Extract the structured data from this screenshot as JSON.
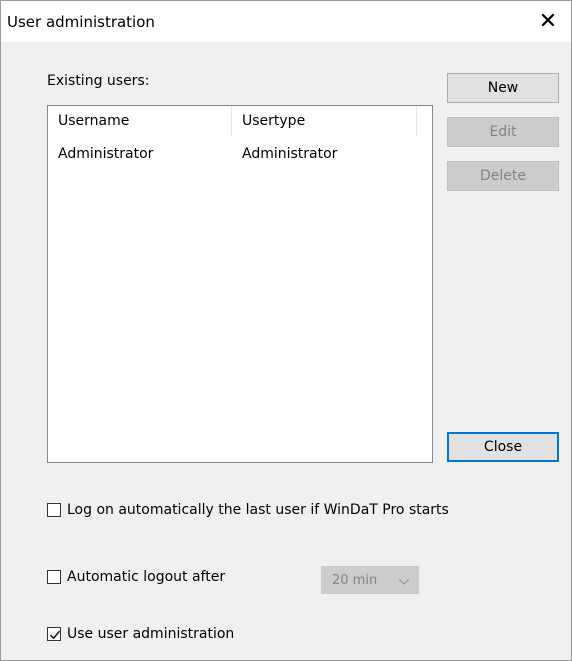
{
  "window": {
    "title": "User administration",
    "close_glyph": "✕"
  },
  "users_section": {
    "label": "Existing users:",
    "columns": [
      "Username",
      "Usertype"
    ],
    "rows": [
      {
        "username": "Administrator",
        "usertype": "Administrator"
      }
    ]
  },
  "buttons": {
    "new": "New",
    "edit": "Edit",
    "delete": "Delete",
    "close": "Close"
  },
  "options": {
    "auto_logon": {
      "label": "Log on automatically the last user if WinDaT Pro starts",
      "checked": false
    },
    "auto_logout": {
      "label": "Automatic logout after",
      "checked": false,
      "timeout_value": "20 min"
    },
    "use_user_admin": {
      "label": "Use user administration",
      "checked": true
    }
  },
  "icons": {
    "close": "close-icon",
    "dropdown": "chevron-down-icon",
    "check": "checkmark-icon"
  }
}
